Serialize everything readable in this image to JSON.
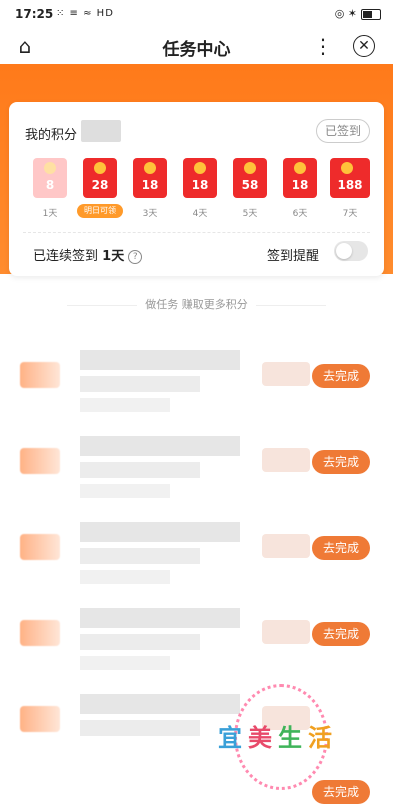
{
  "status_bar": {
    "time": "17:25",
    "left_icons": "⁙ ≡ ≈ HD",
    "right_icons": "◎ ✶"
  },
  "nav": {
    "title": "任务中心",
    "home_icon": "home-icon",
    "more_icon": "more-icon",
    "close_icon": "close-icon"
  },
  "colors": {
    "accent": "#ff7a1a",
    "button": "#ef7a36",
    "envelope": "#ee2b2b"
  },
  "points": {
    "label": "我的积分",
    "signed_label": "已签到"
  },
  "checkin_days": [
    {
      "value": "8",
      "day": "1天"
    },
    {
      "value": "28",
      "day": "明日可领"
    },
    {
      "value": "18",
      "day": "3天"
    },
    {
      "value": "18",
      "day": "4天"
    },
    {
      "value": "58",
      "day": "5天"
    },
    {
      "value": "18",
      "day": "6天"
    },
    {
      "value": "188",
      "day": "7天"
    }
  ],
  "streak": {
    "prefix": "已连续签到",
    "count": "1天",
    "help": "?"
  },
  "reminder": {
    "label": "签到提醒",
    "enabled": false
  },
  "section": {
    "title": "做任务 赚取更多积分"
  },
  "tasks": [
    {
      "button": "去完成"
    },
    {
      "button": "去完成"
    },
    {
      "button": "去完成"
    },
    {
      "button": "去完成"
    },
    {
      "button": "去完成"
    }
  ],
  "watermark": {
    "text": "宜美生活"
  }
}
